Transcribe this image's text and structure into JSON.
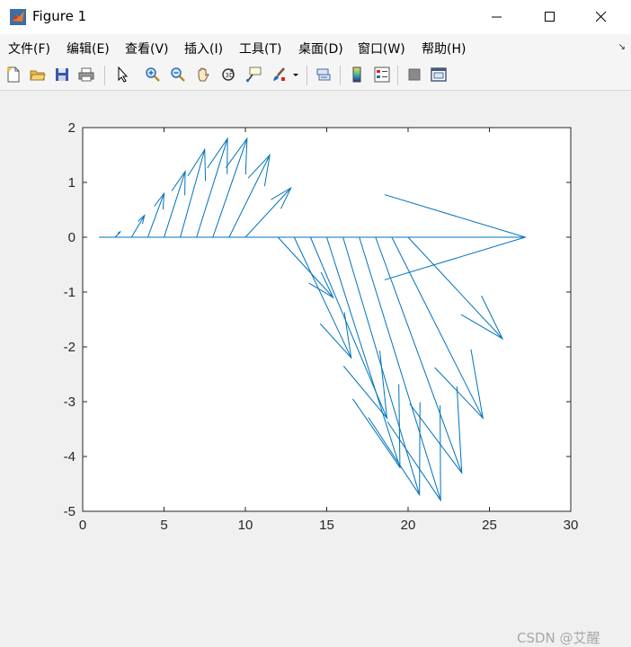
{
  "window": {
    "title": "Figure 1",
    "minimize_icon": "minimize-icon",
    "maximize_icon": "maximize-icon",
    "close_icon": "close-icon",
    "app_icon": "matlab-logo-icon"
  },
  "menu": [
    {
      "label": "文件(F)"
    },
    {
      "label": "编辑(E)"
    },
    {
      "label": "查看(V)"
    },
    {
      "label": "插入(I)"
    },
    {
      "label": "工具(T)"
    },
    {
      "label": "桌面(D)"
    },
    {
      "label": "窗口(W)"
    },
    {
      "label": "帮助(H)"
    }
  ],
  "toolbar": [
    "new-figure-icon",
    "open-file-icon",
    "save-icon",
    "print-icon",
    "select-arrow-icon",
    "zoom-in-icon",
    "zoom-out-icon",
    "pan-hand-icon",
    "rotate-3d-icon",
    "data-cursor-icon",
    "brush-icon",
    "brush-dropdown-icon",
    "link-plot-icon",
    "colorbar-icon",
    "legend-icon",
    "hide-plot-tools-icon",
    "show-plot-tools-icon"
  ],
  "watermark": "CSDN @艾醒",
  "chart_data": {
    "type": "quiver",
    "title": "",
    "xlabel": "",
    "ylabel": "",
    "xlim": [
      0,
      30
    ],
    "ylim": [
      -5,
      2
    ],
    "xticks": [
      0,
      5,
      10,
      15,
      20,
      25,
      30
    ],
    "yticks": [
      -5,
      -4,
      -3,
      -2,
      -1,
      0,
      1,
      2
    ],
    "xtick_labels": [
      "0",
      "5",
      "10",
      "15",
      "20",
      "25",
      "30"
    ],
    "ytick_labels": [
      "-5",
      "-4",
      "-3",
      "-2",
      "-1",
      "0",
      "1",
      "2"
    ],
    "grid": false,
    "color": "#0072BD",
    "arrows": [
      {
        "x": 1,
        "y": 0,
        "u": 26.2,
        "v": 0
      },
      {
        "x": 2,
        "y": 0,
        "u": 0.3,
        "v": 0.1
      },
      {
        "x": 3,
        "y": 0,
        "u": 0.8,
        "v": 0.4
      },
      {
        "x": 4,
        "y": 0,
        "u": 1.0,
        "v": 0.8
      },
      {
        "x": 5,
        "y": 0,
        "u": 1.3,
        "v": 1.2
      },
      {
        "x": 6,
        "y": 0,
        "u": 1.5,
        "v": 1.6
      },
      {
        "x": 7,
        "y": 0,
        "u": 1.9,
        "v": 1.8
      },
      {
        "x": 8,
        "y": 0,
        "u": 2.1,
        "v": 1.8
      },
      {
        "x": 9,
        "y": 0,
        "u": 2.5,
        "v": 1.5
      },
      {
        "x": 10,
        "y": 0,
        "u": 2.8,
        "v": 0.9
      },
      {
        "x": 12,
        "y": 0,
        "u": 3.4,
        "v": -1.1
      },
      {
        "x": 13,
        "y": 0,
        "u": 3.5,
        "v": -2.2
      },
      {
        "x": 14,
        "y": 0,
        "u": 4.7,
        "v": -3.3
      },
      {
        "x": 15,
        "y": 0,
        "u": 4.5,
        "v": -4.2
      },
      {
        "x": 16,
        "y": 0,
        "u": 4.7,
        "v": -4.7
      },
      {
        "x": 17,
        "y": 0,
        "u": 5.0,
        "v": -4.8
      },
      {
        "x": 18,
        "y": 0,
        "u": 5.3,
        "v": -4.3
      },
      {
        "x": 19,
        "y": 0,
        "u": 5.6,
        "v": -3.3
      },
      {
        "x": 20,
        "y": 0,
        "u": 5.8,
        "v": -1.85
      }
    ]
  }
}
